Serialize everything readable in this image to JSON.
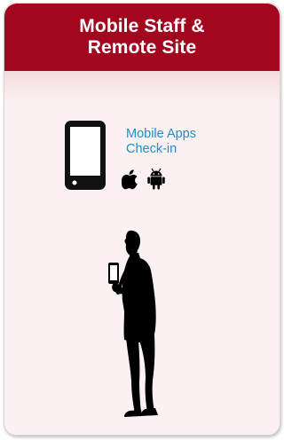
{
  "header": {
    "title_line1": "Mobile Staff &",
    "title_line2": "Remote Site"
  },
  "device": {
    "label_line1": "Mobile Apps",
    "label_line2": "Check-in",
    "icons": [
      "apple-icon",
      "android-icon"
    ]
  },
  "colors": {
    "header_bg": "#a3071f",
    "panel_bg": "#fcf1f2",
    "label_text": "#1a8fc9",
    "silhouette": "#000000"
  }
}
